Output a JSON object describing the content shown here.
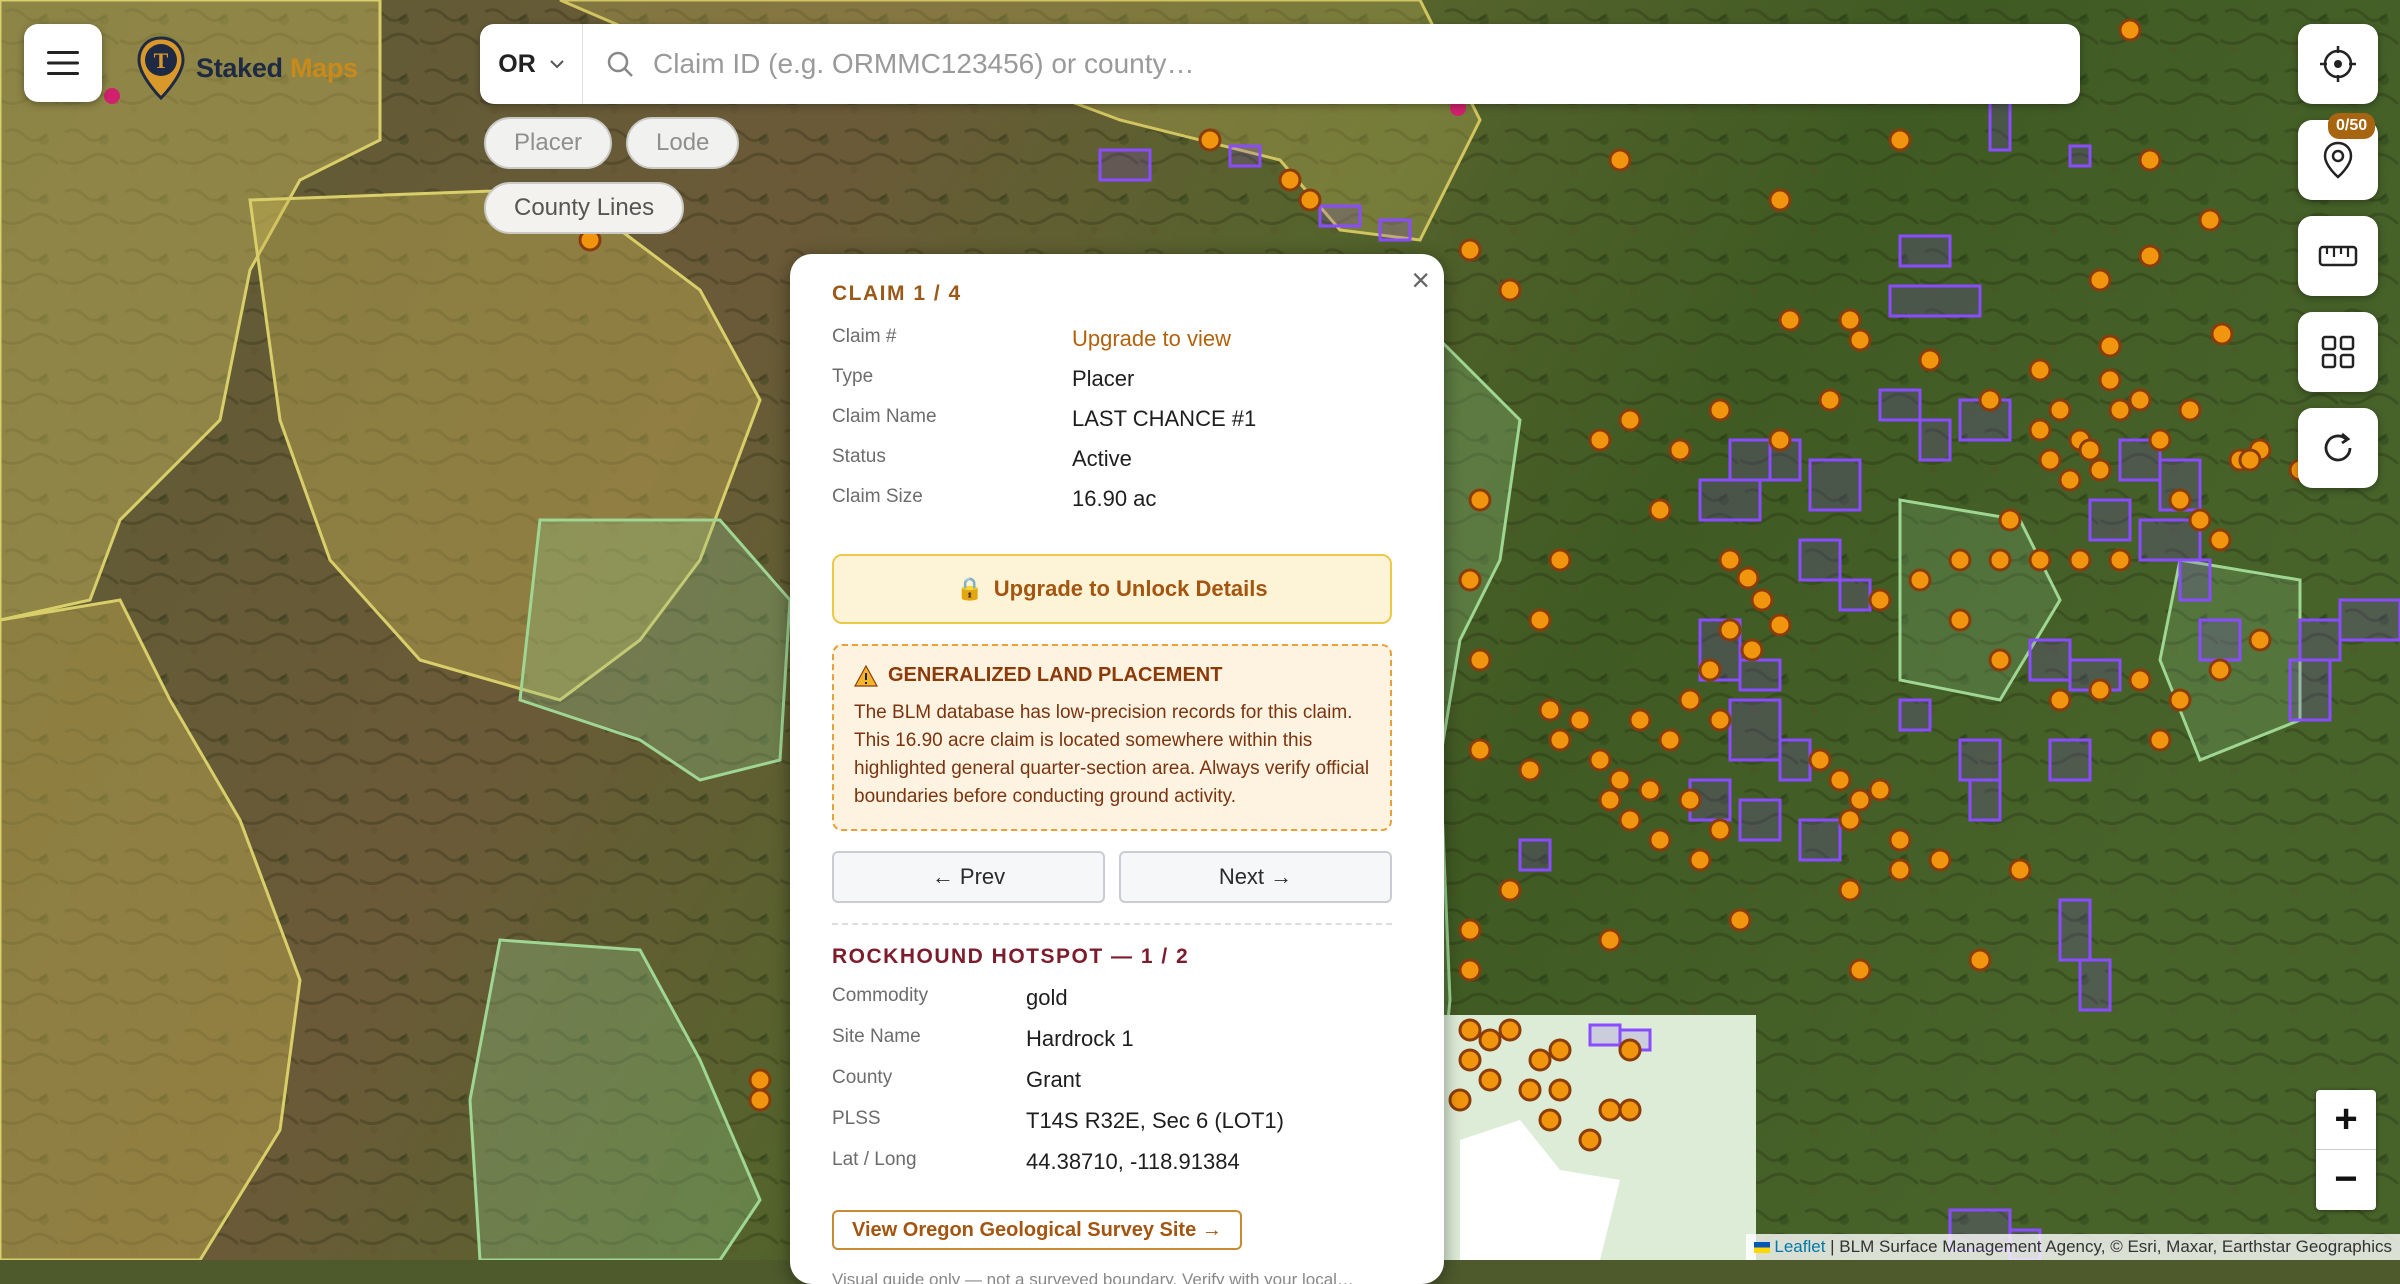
{
  "app": {
    "brand_primary": "Staked",
    "brand_accent": "Maps",
    "logo_letter": "T"
  },
  "search": {
    "state": "OR",
    "placeholder": "Claim ID (e.g. ORMMC123456) or county…"
  },
  "filters": [
    {
      "label": "Placer",
      "active": false
    },
    {
      "label": "Lode",
      "active": false
    },
    {
      "label": "County Lines",
      "active": true
    }
  ],
  "toolbar": {
    "saved_count": "0/50",
    "icons": [
      "locate-icon",
      "pin-icon",
      "ruler-icon",
      "layers-grid-icon",
      "refresh-icon"
    ]
  },
  "popup": {
    "claim": {
      "title": "CLAIM 1 / 4",
      "rows": [
        {
          "label": "Claim #",
          "value": "Upgrade to view"
        },
        {
          "label": "Type",
          "value": "Placer"
        },
        {
          "label": "Claim Name",
          "value": "LAST CHANCE #1"
        },
        {
          "label": "Status",
          "value": "Active"
        },
        {
          "label": "Claim Size",
          "value": "16.90 ac"
        }
      ],
      "unlock_label": "Upgrade to Unlock Details",
      "warning_title": "GENERALIZED LAND PLACEMENT",
      "warning_body": "The BLM database has low-precision records for this claim. This 16.90 acre claim is located somewhere within this highlighted general quarter-section area. Always verify official boundaries before conducting ground activity.",
      "prev_label": "← Prev",
      "next_label": "Next →"
    },
    "hotspot": {
      "title": "ROCKHOUND HOTSPOT — 1 / 2",
      "rows": [
        {
          "label": "Commodity",
          "value": "gold"
        },
        {
          "label": "Site Name",
          "value": "Hardrock 1"
        },
        {
          "label": "County",
          "value": "Grant"
        },
        {
          "label": "PLSS",
          "value": "T14S R32E, Sec 6 (LOT1)"
        },
        {
          "label": "Lat / Long",
          "value": "44.38710, -118.91384"
        }
      ],
      "link_label": "View Oregon Geological Survey Site →",
      "footnote": "Visual guide only — not a surveyed boundary. Verify with your local…"
    }
  },
  "zoom": {
    "in": "+",
    "out": "−"
  },
  "attribution": {
    "leaflet": "Leaflet",
    "sources": "| BLM Surface Management Agency, © Esri, Maxar, Earthstar Geographics"
  },
  "colors": {
    "accent": "#c98a1c",
    "claim_marker": "#f1950f",
    "claim_polygon": "#7a3cf2",
    "blm_land": "#c8b85a",
    "forest_land": "#8ec58a"
  }
}
